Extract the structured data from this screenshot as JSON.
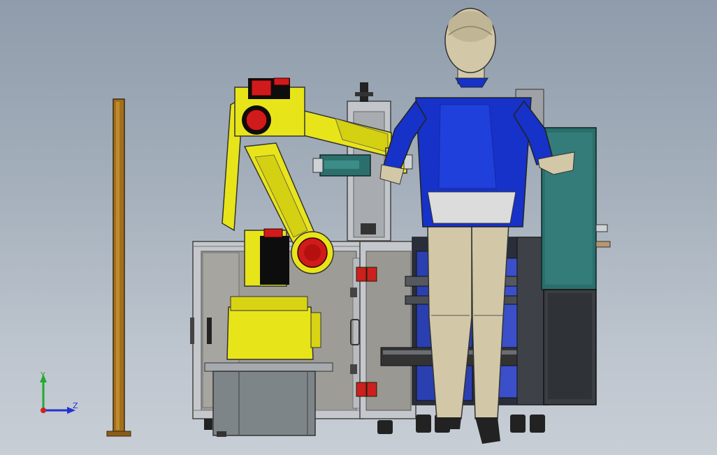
{
  "viewport": {
    "background_top": "#8f9cab",
    "background_bottom": "#c8ced6"
  },
  "triad": {
    "y_label": "Y",
    "z_label": "Z",
    "y_color": "#22aa33",
    "z_color": "#2233cc",
    "x_color": "#cc2222"
  },
  "colors": {
    "robot_yellow": "#e8e41a",
    "robot_dark": "#0d0d0d",
    "robot_red": "#d11a1a",
    "frame_silver": "#c4c8cc",
    "panel_grey": "#9e9c97",
    "teal_panel": "#2a6f6c",
    "figure_blue": "#1632c8",
    "figure_skin": "#d2c8a8",
    "post_brown": "#a26f1a",
    "base_grey": "#7e8588"
  }
}
